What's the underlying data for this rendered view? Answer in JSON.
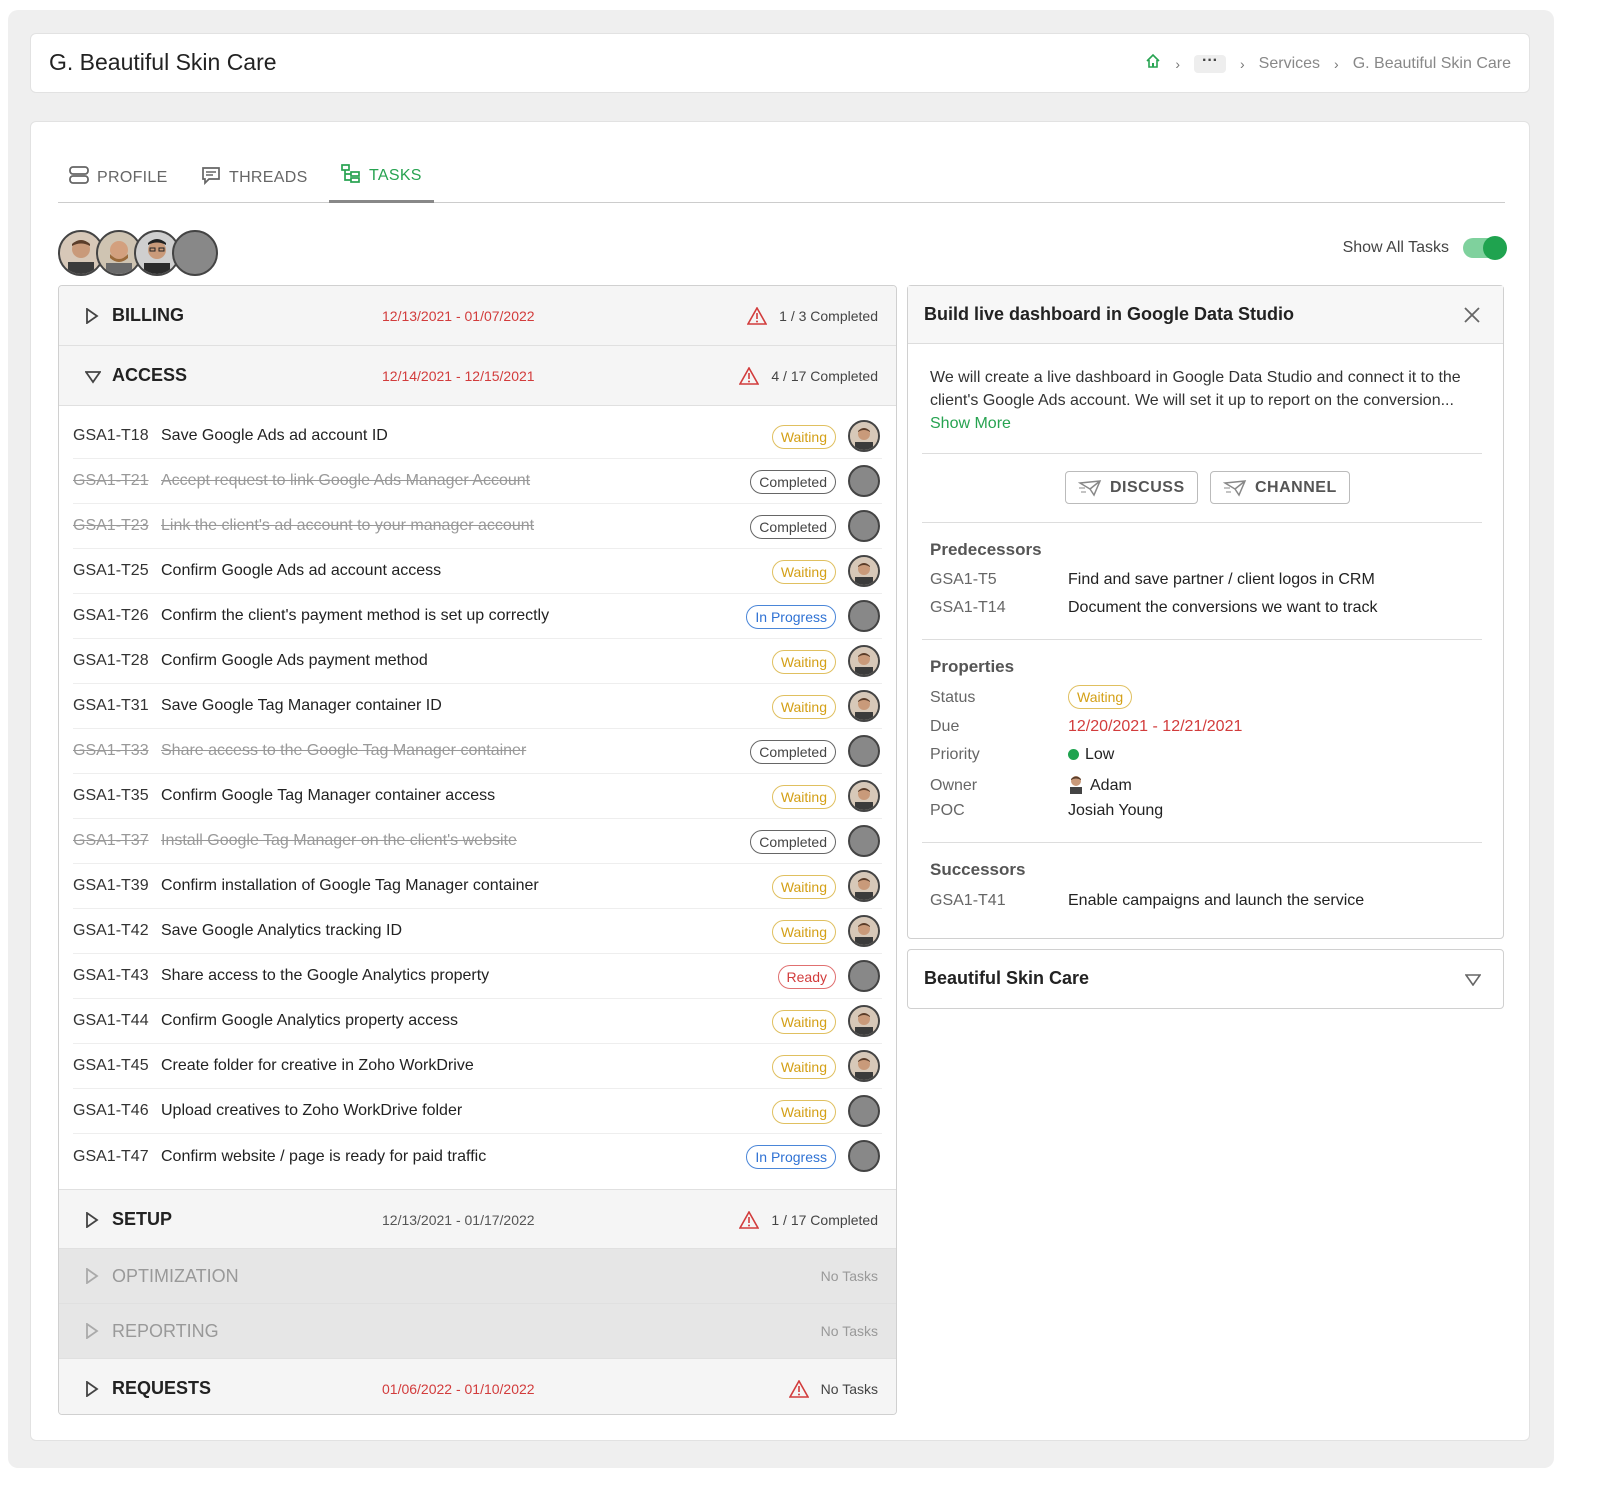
{
  "header": {
    "title": "G. Beautiful Skin Care",
    "breadcrumb": {
      "dots": "···",
      "services": "Services",
      "current": "G. Beautiful Skin Care"
    }
  },
  "tabs": [
    {
      "label": "PROFILE",
      "icon": "profile-icon"
    },
    {
      "label": "THREADS",
      "icon": "threads-icon"
    },
    {
      "label": "TASKS",
      "icon": "tasks-icon",
      "active": true
    }
  ],
  "toggle": {
    "label": "Show All Tasks",
    "on": true
  },
  "sections": [
    {
      "name": "BILLING",
      "dates": "12/13/2021 - 01/07/2022",
      "status": "1 / 3 Completed",
      "expanded": false
    },
    {
      "name": "ACCESS",
      "dates": "12/14/2021 - 12/15/2021",
      "status": "4 / 17 Completed",
      "expanded": true
    },
    {
      "name": "SETUP",
      "dates": "12/13/2021 - 01/17/2022",
      "status": "1 / 17 Completed"
    },
    {
      "name": "OPTIMIZATION",
      "status": "No Tasks"
    },
    {
      "name": "REPORTING",
      "status": "No Tasks"
    },
    {
      "name": "REQUESTS",
      "dates": "01/06/2022 - 01/10/2022",
      "status": "No Tasks"
    }
  ],
  "tasks": [
    {
      "id": "GSA1-T18",
      "title": "Save Google Ads ad account ID",
      "status": "Waiting",
      "avatar": "photo"
    },
    {
      "id": "GSA1-T21",
      "title": "Accept request to link Google Ads Manager Account",
      "status": "Completed",
      "done": true,
      "avatar": "blank"
    },
    {
      "id": "GSA1-T23",
      "title": "Link the client's ad account to your manager account",
      "status": "Completed",
      "done": true,
      "avatar": "blank"
    },
    {
      "id": "GSA1-T25",
      "title": "Confirm Google Ads ad account access",
      "status": "Waiting",
      "avatar": "photo"
    },
    {
      "id": "GSA1-T26",
      "title": "Confirm the client's payment method is set up correctly",
      "status": "In Progress",
      "avatar": "blank"
    },
    {
      "id": "GSA1-T28",
      "title": "Confirm Google Ads payment method",
      "status": "Waiting",
      "avatar": "photo"
    },
    {
      "id": "GSA1-T31",
      "title": "Save Google Tag Manager container ID",
      "status": "Waiting",
      "avatar": "photo"
    },
    {
      "id": "GSA1-T33",
      "title": "Share access to the Google Tag Manager container",
      "status": "Completed",
      "done": true,
      "avatar": "blank"
    },
    {
      "id": "GSA1-T35",
      "title": "Confirm Google Tag Manager container access",
      "status": "Waiting",
      "avatar": "photo"
    },
    {
      "id": "GSA1-T37",
      "title": "Install Google Tag Manager on the client's website",
      "status": "Completed",
      "done": true,
      "avatar": "blank"
    },
    {
      "id": "GSA1-T39",
      "title": "Confirm installation of Google Tag Manager container",
      "status": "Waiting",
      "avatar": "photo"
    },
    {
      "id": "GSA1-T42",
      "title": "Save Google Analytics tracking ID",
      "status": "Waiting",
      "avatar": "photo"
    },
    {
      "id": "GSA1-T43",
      "title": "Share access to the Google Analytics property",
      "status": "Ready",
      "avatar": "blank"
    },
    {
      "id": "GSA1-T44",
      "title": "Confirm Google Analytics property access",
      "status": "Waiting",
      "avatar": "photo"
    },
    {
      "id": "GSA1-T45",
      "title": "Create folder for creative in Zoho WorkDrive",
      "status": "Waiting",
      "avatar": "photo"
    },
    {
      "id": "GSA1-T46",
      "title": "Upload creatives to Zoho WorkDrive folder",
      "status": "Waiting",
      "avatar": "blank"
    },
    {
      "id": "GSA1-T47",
      "title": "Confirm website / page is ready for paid traffic",
      "status": "In Progress",
      "avatar": "blank"
    }
  ],
  "detail": {
    "title": "Build live dashboard in Google Data Studio",
    "description": "We will create a live dashboard in Google Data Studio and connect it to the client's Google Ads account. We will set it up to report on the conversion...",
    "show_more": "Show More",
    "buttons": {
      "discuss": "DISCUSS",
      "channel": "CHANNEL"
    },
    "predecessors_title": "Predecessors",
    "predecessors": [
      {
        "id": "GSA1-T5",
        "title": "Find and save partner / client logos in CRM"
      },
      {
        "id": "GSA1-T14",
        "title": "Document the conversions we want to track"
      }
    ],
    "properties_title": "Properties",
    "properties": {
      "status_label": "Status",
      "status": "Waiting",
      "due_label": "Due",
      "due": "12/20/2021 - 12/21/2021",
      "priority_label": "Priority",
      "priority": "Low",
      "owner_label": "Owner",
      "owner": "Adam",
      "poc_label": "POC",
      "poc": "Josiah Young"
    },
    "successors_title": "Successors",
    "successors": [
      {
        "id": "GSA1-T41",
        "title": "Enable campaigns and launch the service"
      }
    ]
  },
  "client_panel": {
    "title": "Beautiful Skin Care"
  },
  "colors": {
    "accent": "#27a351",
    "danger": "#d23c3c",
    "waiting": "#d4a017",
    "progress": "#2f72d4"
  }
}
